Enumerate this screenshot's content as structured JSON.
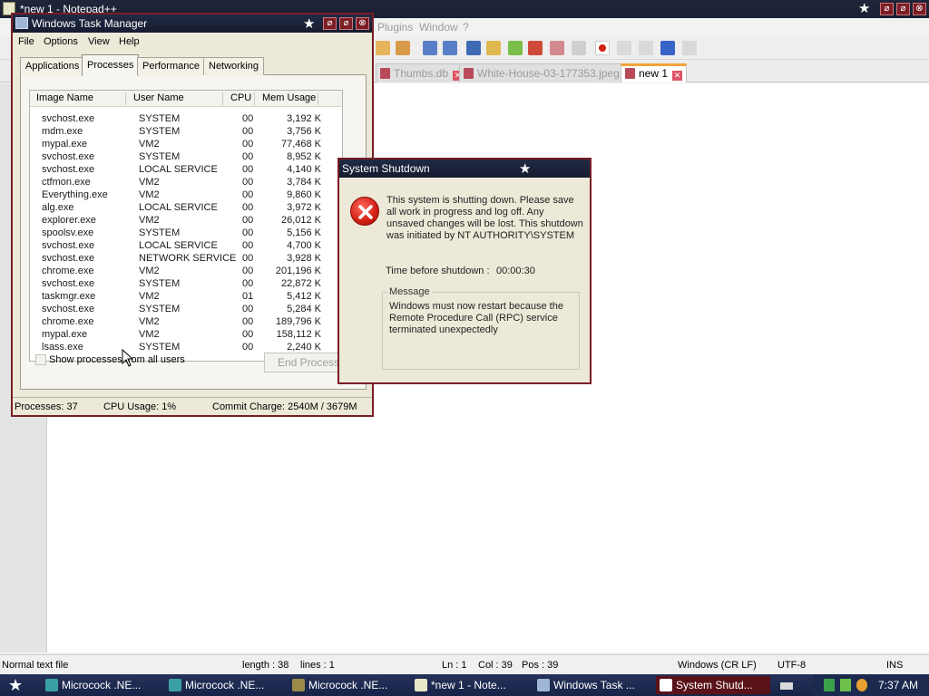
{
  "notepad": {
    "title": "*new 1 - Notepad++",
    "menu": [
      "Plugins",
      "Window",
      "?"
    ],
    "tabs": [
      {
        "label": "Thumbs.db",
        "active": false
      },
      {
        "label": "White-House-03-177353.jpeg",
        "active": false
      },
      {
        "label": "new 1",
        "active": true
      }
    ],
    "status": {
      "type": "Normal text file",
      "length": "length : 38",
      "lines": "lines : 1",
      "ln": "Ln : 1",
      "col": "Col : 39",
      "pos": "Pos : 39",
      "eol": "Windows (CR LF)",
      "encoding": "UTF-8",
      "mode": "INS"
    }
  },
  "taskmgr": {
    "title": "Windows Task Manager",
    "menu": [
      "File",
      "Options",
      "View",
      "Help"
    ],
    "tabs": [
      {
        "label": "Applications",
        "active": false
      },
      {
        "label": "Processes",
        "active": true
      },
      {
        "label": "Performance",
        "active": false
      },
      {
        "label": "Networking",
        "active": false
      }
    ],
    "columns": [
      "Image Name",
      "User Name",
      "CPU",
      "Mem Usage"
    ],
    "rows": [
      {
        "name": "svchost.exe",
        "user": "SYSTEM",
        "cpu": "00",
        "mem": "3,192 K"
      },
      {
        "name": "mdm.exe",
        "user": "SYSTEM",
        "cpu": "00",
        "mem": "3,756 K"
      },
      {
        "name": "mypal.exe",
        "user": "VM2",
        "cpu": "00",
        "mem": "77,468 K"
      },
      {
        "name": "svchost.exe",
        "user": "SYSTEM",
        "cpu": "00",
        "mem": "8,952 K"
      },
      {
        "name": "svchost.exe",
        "user": "LOCAL SERVICE",
        "cpu": "00",
        "mem": "4,140 K"
      },
      {
        "name": "ctfmon.exe",
        "user": "VM2",
        "cpu": "00",
        "mem": "3,784 K"
      },
      {
        "name": "Everything.exe",
        "user": "VM2",
        "cpu": "00",
        "mem": "9,860 K"
      },
      {
        "name": "alg.exe",
        "user": "LOCAL SERVICE",
        "cpu": "00",
        "mem": "3,972 K"
      },
      {
        "name": "explorer.exe",
        "user": "VM2",
        "cpu": "00",
        "mem": "26,012 K"
      },
      {
        "name": "spoolsv.exe",
        "user": "SYSTEM",
        "cpu": "00",
        "mem": "5,156 K"
      },
      {
        "name": "svchost.exe",
        "user": "LOCAL SERVICE",
        "cpu": "00",
        "mem": "4,700 K"
      },
      {
        "name": "svchost.exe",
        "user": "NETWORK SERVICE",
        "cpu": "00",
        "mem": "3,928 K"
      },
      {
        "name": "chrome.exe",
        "user": "VM2",
        "cpu": "00",
        "mem": "201,196 K"
      },
      {
        "name": "svchost.exe",
        "user": "SYSTEM",
        "cpu": "00",
        "mem": "22,872 K"
      },
      {
        "name": "taskmgr.exe",
        "user": "VM2",
        "cpu": "01",
        "mem": "5,412 K"
      },
      {
        "name": "svchost.exe",
        "user": "SYSTEM",
        "cpu": "00",
        "mem": "5,284 K"
      },
      {
        "name": "chrome.exe",
        "user": "VM2",
        "cpu": "00",
        "mem": "189,796 K"
      },
      {
        "name": "mypal.exe",
        "user": "VM2",
        "cpu": "00",
        "mem": "158,112 K"
      },
      {
        "name": "lsass.exe",
        "user": "SYSTEM",
        "cpu": "00",
        "mem": "2,240 K"
      }
    ],
    "show_all_label": "Show processes from all users",
    "end_process_label": "End Process",
    "status": {
      "processes": "Processes: 37",
      "cpu": "CPU Usage: 1%",
      "commit": "Commit Charge: 2540M / 3679M"
    }
  },
  "shutdown": {
    "title": "System Shutdown",
    "message": "This system is shutting down. Please save all work in progress and log off. Any unsaved changes will be lost. This shutdown was initiated by NT AUTHORITY\\SYSTEM",
    "time_label": "Time before shutdown :",
    "time_value": "00:00:30",
    "group_label": "Message",
    "group_text": "Windows must now restart because the Remote Procedure Call (RPC) service terminated unexpectedly"
  },
  "taskbar": {
    "tasks": [
      {
        "label": "Microcock .NE...",
        "active": false,
        "color": "#3aa0a8"
      },
      {
        "label": "Microcock .NE...",
        "active": false,
        "color": "#3aa0a8"
      },
      {
        "label": "Microcock .NE...",
        "active": false,
        "color": "#9b8a4a"
      },
      {
        "label": "*new 1 - Note...",
        "active": false,
        "color": "#e9e7c9"
      },
      {
        "label": "Windows Task ...",
        "active": false,
        "color": "#9fb6d6"
      },
      {
        "label": "System Shutd...",
        "active": true,
        "color": "#ffffff"
      }
    ],
    "clock": "7:37 AM"
  },
  "colors": {
    "title_bar": "#1a1f33",
    "window_border": "#7a1d26",
    "accent_tab": "#f2a23a",
    "error_red": "#d21f14"
  }
}
